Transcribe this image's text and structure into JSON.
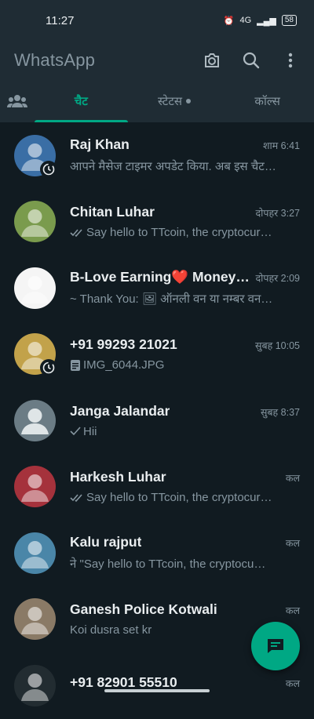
{
  "status_bar": {
    "time": "11:27",
    "network": "4G",
    "battery": "58"
  },
  "app": {
    "title": "WhatsApp"
  },
  "tabs": [
    {
      "label": "चैट",
      "active": true
    },
    {
      "label": "स्टेटस",
      "active": false,
      "dot": true
    },
    {
      "label": "कॉल्स",
      "active": false
    }
  ],
  "chats": [
    {
      "name": "Raj Khan",
      "time": "शाम 6:41",
      "message": "आपने मैसेज टाइमर अपडेट किया. अब इस चैट…",
      "tick": "",
      "timer": true,
      "avatar_color": "#3a6ea5"
    },
    {
      "name": "Chitan Luhar",
      "time": "दोपहर 3:27",
      "message": "Say hello to TTcoin, the cryptocur…",
      "tick": "double",
      "timer": false,
      "avatar_color": "#7a9b4d"
    },
    {
      "name": "B-Love Earning❤️ Money…",
      "time": "दोपहर 2:09",
      "message": "~ Thank You: 🖼 ऑनली वन  या नम्बर वन…",
      "tick": "",
      "timer": false,
      "avatar_color": "#f5f5f5"
    },
    {
      "name": "+91 99293 21021",
      "time": "सुबह 10:05",
      "message": "IMG_6044.JPG",
      "tick": "",
      "doc": true,
      "timer": true,
      "avatar_color": "#c2a24a"
    },
    {
      "name": "Janga Jalandar",
      "time": "सुबह 8:37",
      "message": "Hii",
      "tick": "single",
      "timer": false,
      "avatar_color": "#6b7c85",
      "default_avatar": true
    },
    {
      "name": "Harkesh Luhar",
      "time": "कल",
      "message": "Say hello to TTcoin, the cryptocur…",
      "tick": "double",
      "timer": false,
      "avatar_color": "#a5323c"
    },
    {
      "name": "Kalu rajput",
      "time": "कल",
      "message": "ने \"Say hello to TTcoin, the cryptocu…",
      "tick": "",
      "timer": false,
      "avatar_color": "#4a86a8"
    },
    {
      "name": "Ganesh Police Kotwali",
      "time": "कल",
      "message": "Koi dusra set kr",
      "tick": "",
      "timer": false,
      "avatar_color": "#8a7a66"
    },
    {
      "name": "+91 82901 55510",
      "time": "कल",
      "message": "",
      "tick": "",
      "timer": false,
      "avatar_color": "#222c31"
    }
  ],
  "colors": {
    "background": "#111b21",
    "header": "#1f2c34",
    "accent": "#00a884",
    "muted": "#8696a0"
  }
}
